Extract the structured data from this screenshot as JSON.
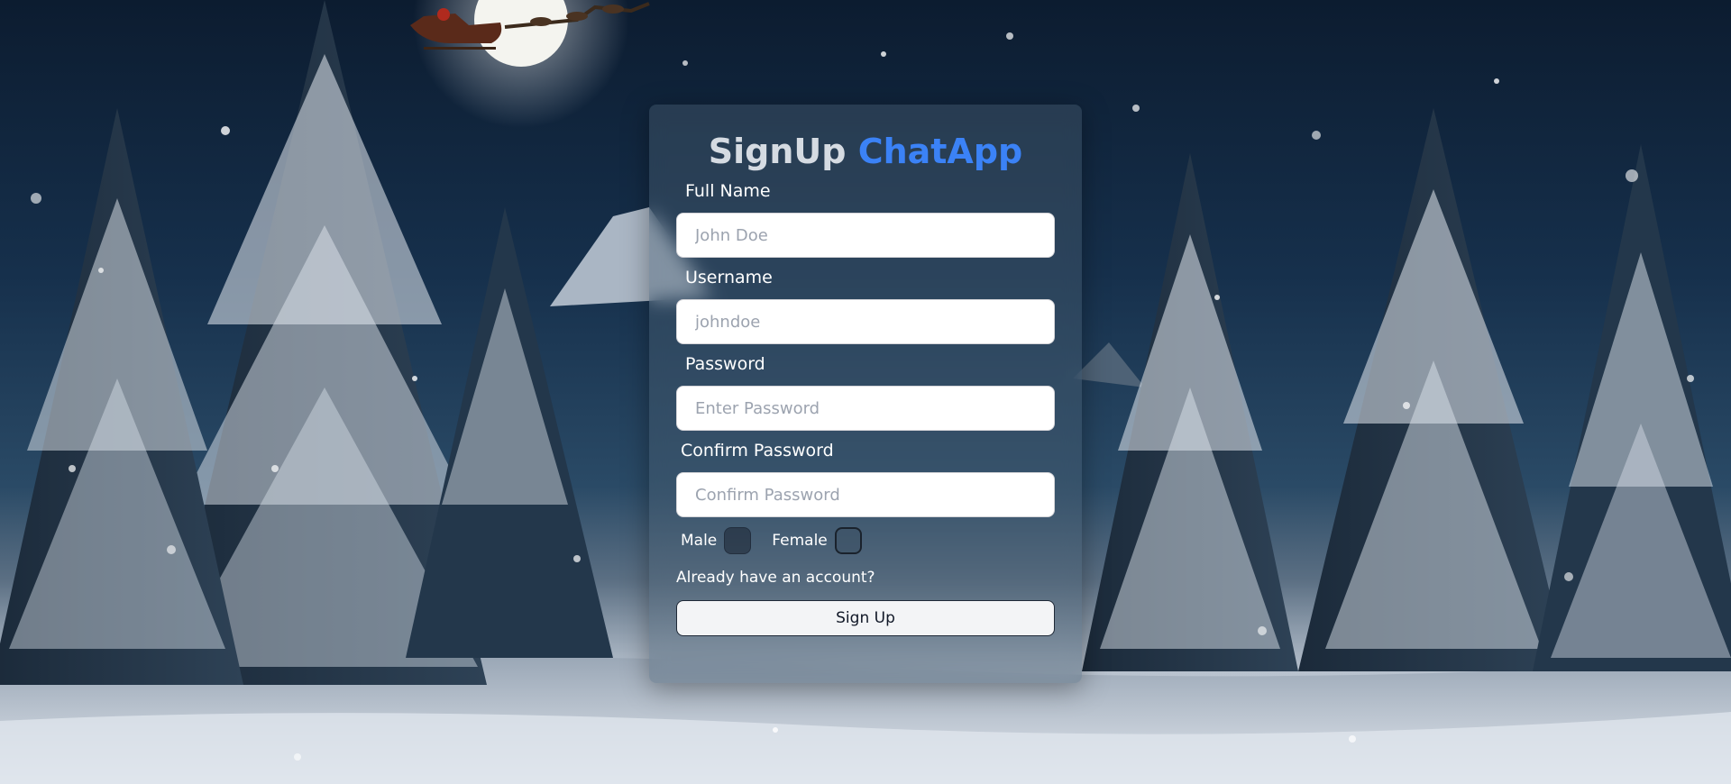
{
  "form": {
    "title_prefix": "SignUp",
    "title_brand": "ChatApp",
    "fields": [
      {
        "label": "Full Name",
        "placeholder": "John Doe",
        "value": ""
      },
      {
        "label": "Username",
        "placeholder": "johndoe",
        "value": ""
      },
      {
        "label": "Password",
        "placeholder": "Enter Password",
        "value": ""
      },
      {
        "label": "Confirm Password",
        "placeholder": "Confirm Password",
        "value": ""
      }
    ],
    "gender": {
      "male_label": "Male",
      "female_label": "Female",
      "male_checked": false,
      "female_checked": false
    },
    "signin_link_text": "Already have an account?",
    "submit_label": "Sign Up"
  },
  "theme": {
    "brand_color": "#3b82f6",
    "title_color": "#d5dbe2",
    "label_color": "#ffffff",
    "input_background": "#ffffff",
    "button_background": "#f3f4f6"
  },
  "background": {
    "scene": "snowy pine forest at night with full moon and santa sleigh",
    "icons": [
      "moon-icon",
      "santa-sleigh-icon",
      "pine-tree-icon",
      "snowflake-icon"
    ]
  }
}
